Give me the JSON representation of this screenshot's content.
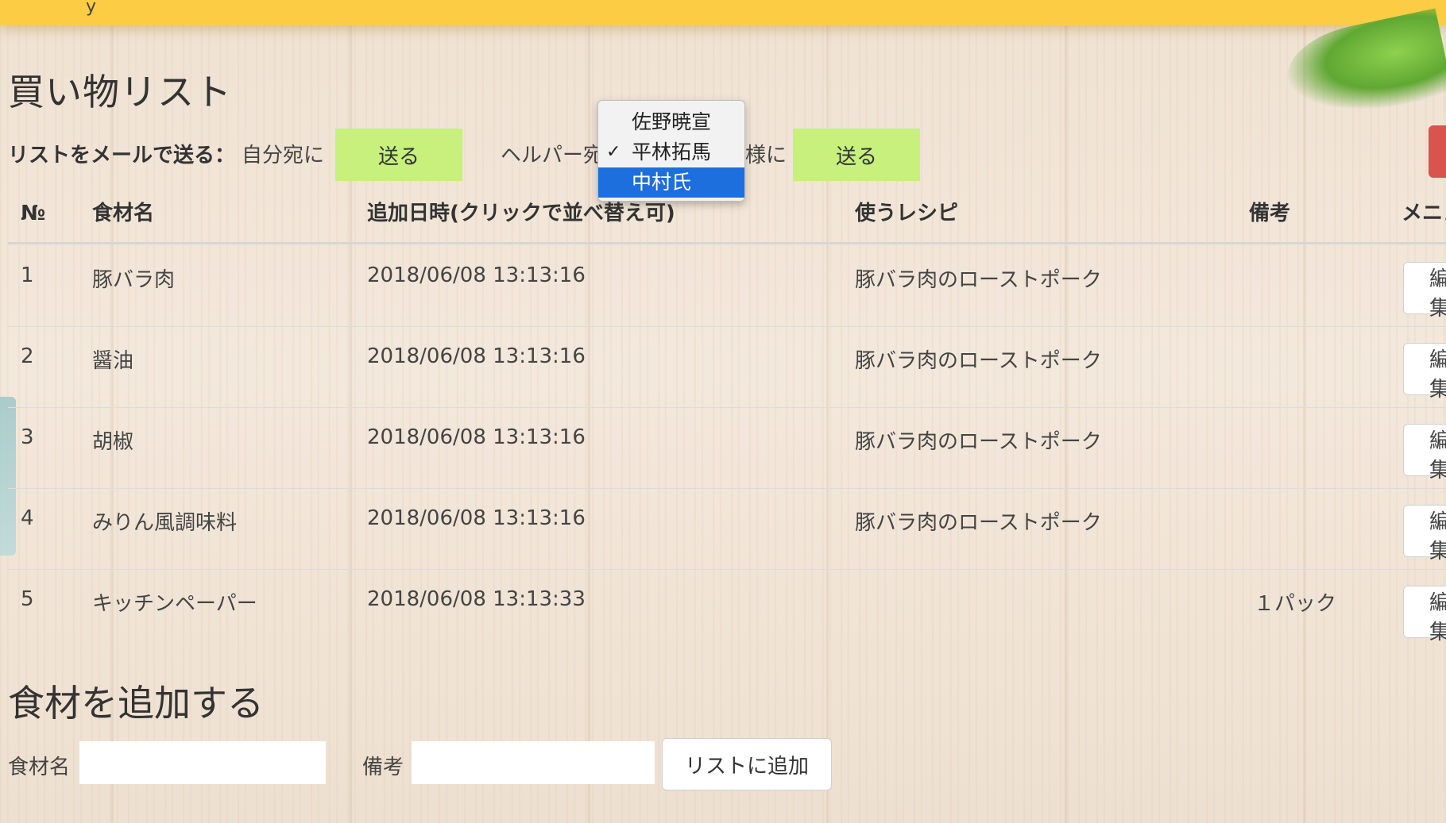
{
  "header": {
    "logo_fragment": "y"
  },
  "page": {
    "title": "買い物リスト"
  },
  "mail": {
    "label": "リストをメールで送る：",
    "self_label": "自分宛に",
    "send_self_button": "送る",
    "helper_prefix": "ヘルパー宛",
    "helper_suffix": "様に",
    "send_helper_button": "送る",
    "helper_options": [
      "佐野暁宣",
      "平林拓馬",
      "中村氏"
    ],
    "checked_option": "平林拓馬",
    "highlighted_option": "中村氏"
  },
  "table": {
    "headers": {
      "no": "№",
      "name": "食材名",
      "date": "追加日時(クリックで並べ替え可)",
      "recipe": "使うレシピ",
      "note": "備考",
      "menu": "メニュー"
    },
    "edit_label": "編集",
    "rows": [
      {
        "no": "1",
        "name": "豚バラ肉",
        "date": "2018/06/08 13:13:16",
        "recipe": "豚バラ肉のローストポーク",
        "note": ""
      },
      {
        "no": "2",
        "name": "醤油",
        "date": "2018/06/08 13:13:16",
        "recipe": "豚バラ肉のローストポーク",
        "note": ""
      },
      {
        "no": "3",
        "name": "胡椒",
        "date": "2018/06/08 13:13:16",
        "recipe": "豚バラ肉のローストポーク",
        "note": ""
      },
      {
        "no": "4",
        "name": "みりん風調味料",
        "date": "2018/06/08 13:13:16",
        "recipe": "豚バラ肉のローストポーク",
        "note": ""
      },
      {
        "no": "5",
        "name": "キッチンペーパー",
        "date": "2018/06/08 13:13:33",
        "recipe": "",
        "note": "１パック"
      }
    ]
  },
  "add": {
    "title": "食材を追加する",
    "name_label": "食材名",
    "name_value": "",
    "note_label": "備考",
    "note_value": "",
    "add_button": "リストに追加"
  },
  "colors": {
    "topbar": "#fccc44",
    "send_button": "#c7f07d",
    "dropdown_highlight": "#1c6fdc"
  }
}
